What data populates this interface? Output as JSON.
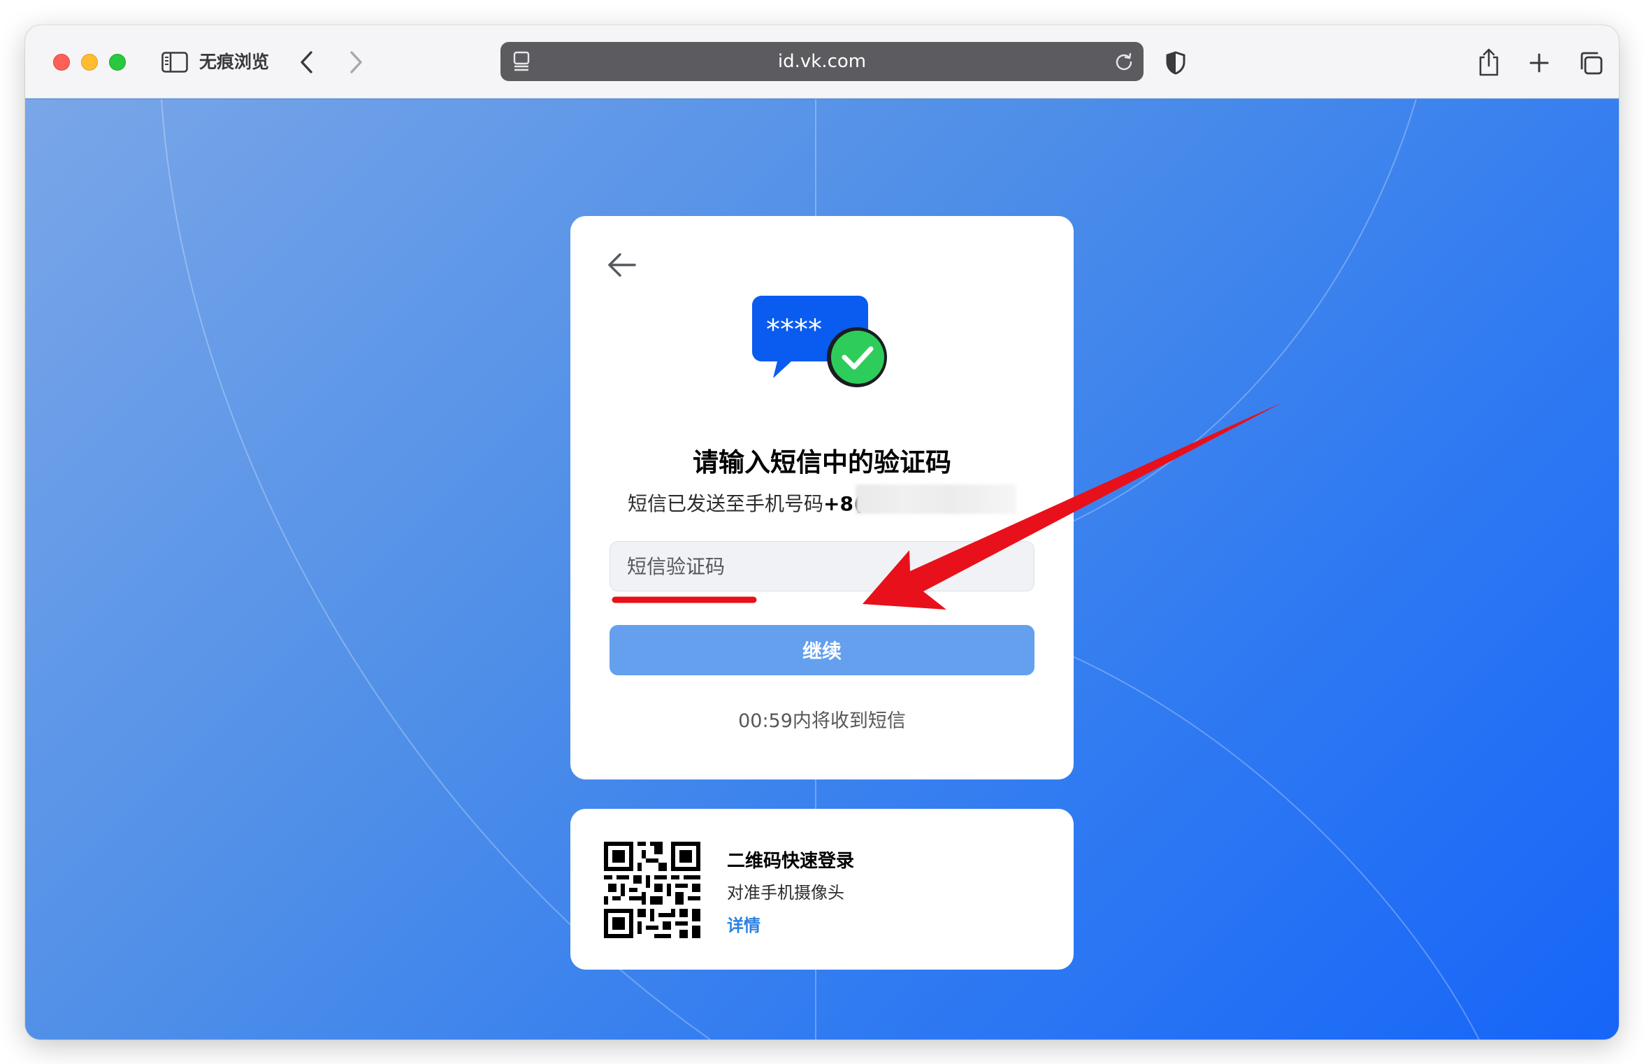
{
  "browser": {
    "private_label": "无痕浏览",
    "url": "id.vk.com"
  },
  "card": {
    "title": "请输入短信中的验证码",
    "subtitle_prefix": "短信已发送至手机号码",
    "phone_visible": "+8(",
    "code_placeholder": "短信验证码",
    "continue_label": "继续",
    "timer_text": "00:59内将收到短信",
    "masked_code": "****"
  },
  "qr_card": {
    "title": "二维码快速登录",
    "subtitle": "对准手机摄像头",
    "link": "详情"
  },
  "colors": {
    "accent_blue": "#0077ff",
    "button_disabled": "#64a0ee",
    "link_blue": "#2d81e0",
    "success_green": "#2ecc5b",
    "annotation_red": "#e8101a"
  },
  "icons": [
    "sidebar-icon",
    "chevron-left-icon",
    "chevron-right-icon",
    "page-icon",
    "reload-icon",
    "shield-icon",
    "share-icon",
    "plus-icon",
    "tabs-icon",
    "back-arrow-icon",
    "sms-check-icon",
    "qr-code-icon"
  ]
}
